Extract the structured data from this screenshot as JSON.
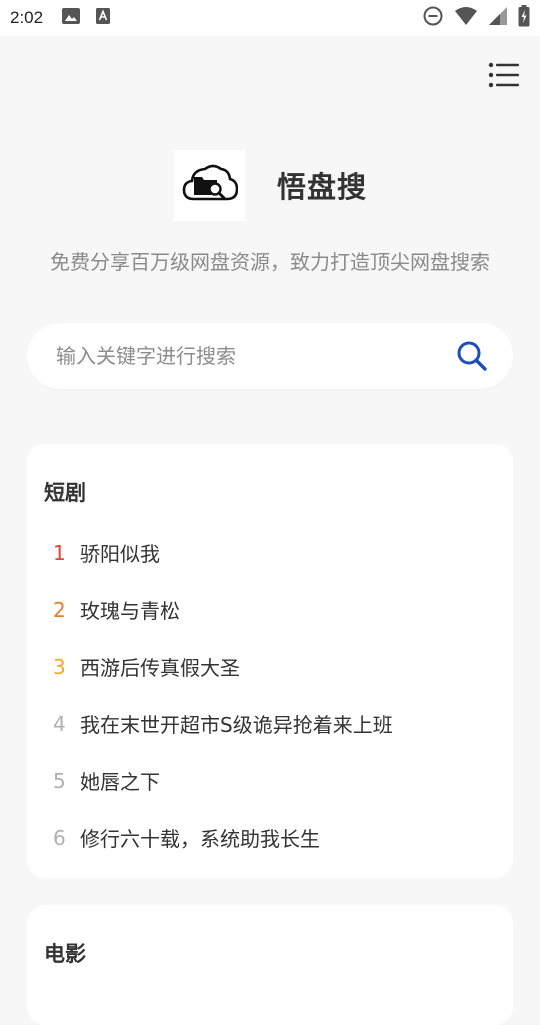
{
  "status_bar": {
    "time": "2:02",
    "left_icons": [
      "image-icon",
      "text-a-icon"
    ],
    "right_icons": [
      "do-not-disturb-icon",
      "wifi-icon",
      "cell-signal-icon",
      "battery-icon"
    ]
  },
  "header": {
    "menu_icon": "menu-icon"
  },
  "brand": {
    "logo_icon": "cloud-folder-search-icon",
    "name": "悟盘搜",
    "slogan": "免费分享百万级网盘资源，致力打造顶尖网盘搜索"
  },
  "search": {
    "placeholder": "输入关键字进行搜索",
    "value": "",
    "icon": "search-icon",
    "icon_color": "#1d4fb8"
  },
  "sections": [
    {
      "title": "短剧",
      "items": [
        {
          "rank": "1",
          "title": "骄阳似我",
          "color": "#e8413a"
        },
        {
          "rank": "2",
          "title": "玫瑰与青松",
          "color": "#f07a1f"
        },
        {
          "rank": "3",
          "title": "西游后传真假大圣",
          "color": "#f2a922"
        },
        {
          "rank": "4",
          "title": "我在末世开超市S级诡异抢着来上班",
          "color": "#b0b0b0"
        },
        {
          "rank": "5",
          "title": "她唇之下",
          "color": "#b0b0b0"
        },
        {
          "rank": "6",
          "title": "修行六十载，系统助我长生",
          "color": "#b0b0b0"
        }
      ]
    },
    {
      "title": "电影",
      "items": []
    }
  ]
}
